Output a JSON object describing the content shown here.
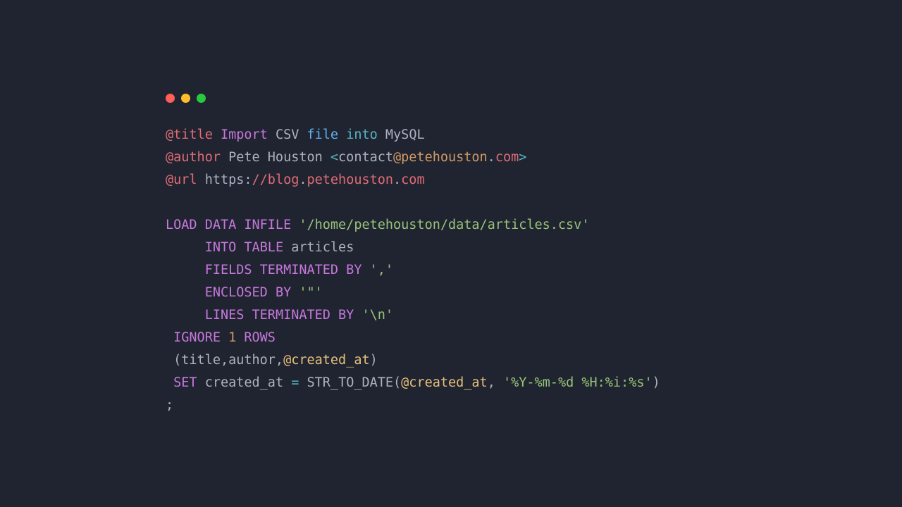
{
  "traffic_lights": {
    "red": "#ff5f56",
    "yellow": "#ffbd2e",
    "green": "#27c93f"
  },
  "l1": {
    "tag": "@title",
    "w1": "Import",
    "w2": "CSV",
    "w3": "file",
    "w4": "into",
    "w5": "MySQL"
  },
  "l2": {
    "tag": "@author",
    "name": "Pete Houston ",
    "lt": "<",
    "user": "contact",
    "at": "@petehouston",
    "dot": ".",
    "tld": "com",
    "gt": ">"
  },
  "l3": {
    "tag": "@url",
    "proto": "https:",
    "slashes": "//blog",
    "dot1": ".",
    "host": "petehouston",
    "dot2": ".",
    "tld": "com"
  },
  "l5": {
    "kw": "LOAD DATA INFILE",
    "str": "'/home/petehouston/data/articles.csv'"
  },
  "l6": {
    "kw": "INTO TABLE",
    "id": "articles"
  },
  "l7": {
    "kw": "FIELDS TERMINATED BY",
    "str": "','"
  },
  "l8": {
    "kw": "ENCLOSED BY",
    "str": "'\"'"
  },
  "l9": {
    "kw": "LINES TERMINATED BY",
    "str": "'\\n'"
  },
  "l10": {
    "kw1": "IGNORE",
    "num": "1",
    "kw2": "ROWS"
  },
  "l11": {
    "open": " (title,author,",
    "var": "@created_at",
    "close": ")"
  },
  "l12": {
    "kw": "SET",
    "lhs": "created_at ",
    "eq": "=",
    "fn": " STR_TO_DATE(",
    "var": "@created_at",
    "comma": ", ",
    "str": "'%Y-%m-%d %H:%i:%s'",
    "close": ")"
  },
  "l13": {
    "semi": ";"
  }
}
